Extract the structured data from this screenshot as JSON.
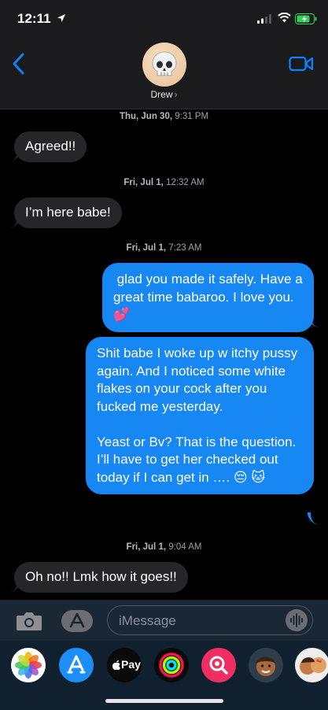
{
  "status_bar": {
    "time": "12:11"
  },
  "header": {
    "contact_name": "Drew",
    "chevron": "›"
  },
  "messages": [
    {
      "timestamp_day": "Thu, Jun 30,",
      "timestamp_time": "9:31 PM"
    },
    {
      "direction": "incoming",
      "text": "Agreed!!"
    },
    {
      "timestamp_day": "Fri, Jul 1,",
      "timestamp_time": "12:32 AM"
    },
    {
      "direction": "incoming",
      "text": "I’m here babe!"
    },
    {
      "timestamp_day": "Fri, Jul 1,",
      "timestamp_time": "7:23 AM"
    },
    {
      "direction": "outgoing",
      "text": " glad you made it safely. Have a great time babaroo. I love you. 💕"
    },
    {
      "direction": "outgoing",
      "text": "Shit babe I woke up w itchy pussy again. And I noticed some white flakes on your cock after you fucked me yesterday.\n\nYeast or Bv? That is the question.\nI’ll have to get her checked out today if I can get in …. 😔 🐱"
    },
    {
      "timestamp_day": "Fri, Jul 1,",
      "timestamp_time": "9:04 AM"
    },
    {
      "direction": "incoming",
      "text": "Oh no!! Lmk how it goes!!"
    }
  ],
  "input": {
    "placeholder": "iMessage"
  },
  "dock": {
    "apps": [
      "photos-icon",
      "app-store-icon",
      "apple-pay-icon",
      "activity-icon",
      "search-images-icon",
      "memoji-icon",
      "memoji-sticker-icon"
    ],
    "apple_pay_label": "Pay"
  },
  "colors": {
    "outgoing_bubble": "#1787f4",
    "incoming_bubble": "#262628",
    "accent": "#0a84ff"
  }
}
